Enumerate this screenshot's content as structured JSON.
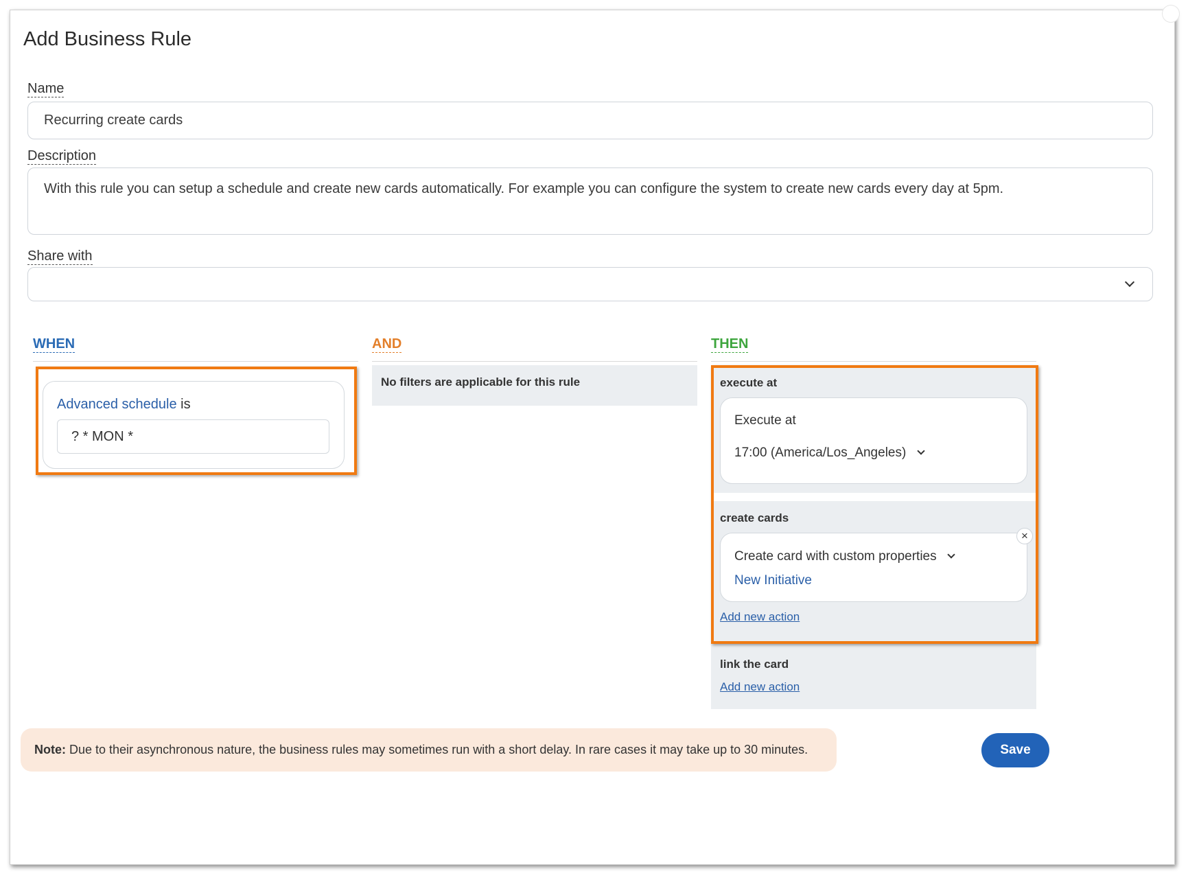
{
  "dialog": {
    "title": "Add Business Rule"
  },
  "form": {
    "name_label": "Name",
    "name_value": "Recurring create cards",
    "description_label": "Description",
    "description_value": "With this rule you can setup a schedule and create new cards automatically. For example you can configure the system to create new cards every day at 5pm.",
    "share_label": "Share with",
    "share_value": ""
  },
  "when": {
    "heading": "WHEN",
    "condition_link": "Advanced schedule",
    "condition_suffix": "is",
    "schedule_value": "? * MON *"
  },
  "and": {
    "heading": "AND",
    "empty_text": "No filters are applicable for this rule"
  },
  "then": {
    "heading": "THEN",
    "execute_section": "execute at",
    "execute_card_title": "Execute at",
    "execute_time": "17:00 (America/Los_Angeles)",
    "create_section": "create cards",
    "create_option": "Create card with custom properties",
    "create_target": "New Initiative",
    "close_symbol": "×",
    "add_action_1": "Add new action",
    "link_section": "link the card",
    "add_action_2": "Add new action"
  },
  "footer": {
    "note_label": "Note:",
    "note_text": " Due to their asynchronous nature, the business rules may sometimes run with a short delay. In rare cases it may take up to 30 minutes.",
    "save_label": "Save"
  },
  "colors": {
    "when_blue": "#2a6bb5",
    "and_orange": "#e37f2a",
    "then_green": "#3da53d",
    "highlight_orange": "#f07a12",
    "save_blue": "#2263b8",
    "note_background": "#fbe9dc"
  }
}
